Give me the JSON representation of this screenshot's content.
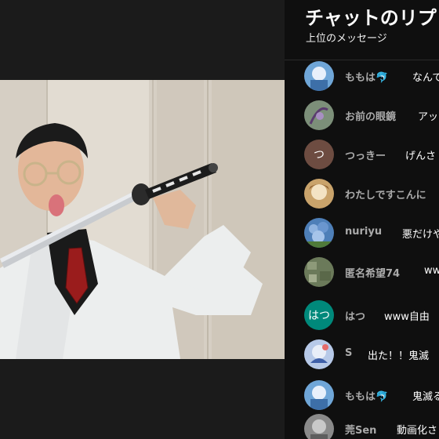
{
  "chat": {
    "title": "チャットのリプ",
    "subtitle": "上位のメッセージ",
    "messages": [
      {
        "author": "ももは🐬",
        "text": "なんで",
        "avatar_color": "#6fa6d8",
        "avatar_letter": ""
      },
      {
        "author": "お前の眼鏡",
        "text": "アッ",
        "avatar_color": "#7c8f79",
        "avatar_letter": ""
      },
      {
        "author": "つっきー",
        "text": "げんさ",
        "avatar_color": "#6d4c41",
        "avatar_letter": "つ"
      },
      {
        "author": "わたしですこんに",
        "text": "",
        "avatar_color": "#c9a36b",
        "avatar_letter": ""
      },
      {
        "author": "nuriyu",
        "text": "悪だけや",
        "avatar_color": "#4e7fb8",
        "avatar_letter": ""
      },
      {
        "author": "匿名希望74",
        "text": "ww",
        "avatar_color": "#6b7a5a",
        "avatar_letter": ""
      },
      {
        "author": "はつ",
        "text": "www自由",
        "avatar_color": "#00897b",
        "avatar_letter": "はつ"
      },
      {
        "author": "S",
        "text": "出た！！鬼滅",
        "avatar_color": "#b7c9e8",
        "avatar_letter": ""
      },
      {
        "author": "ももは🐬",
        "text": "鬼滅る",
        "avatar_color": "#6fa6d8",
        "avatar_letter": ""
      },
      {
        "author": "莞Sen",
        "text": "動画化さ",
        "avatar_color": "#8a8a8a",
        "avatar_letter": ""
      }
    ]
  }
}
